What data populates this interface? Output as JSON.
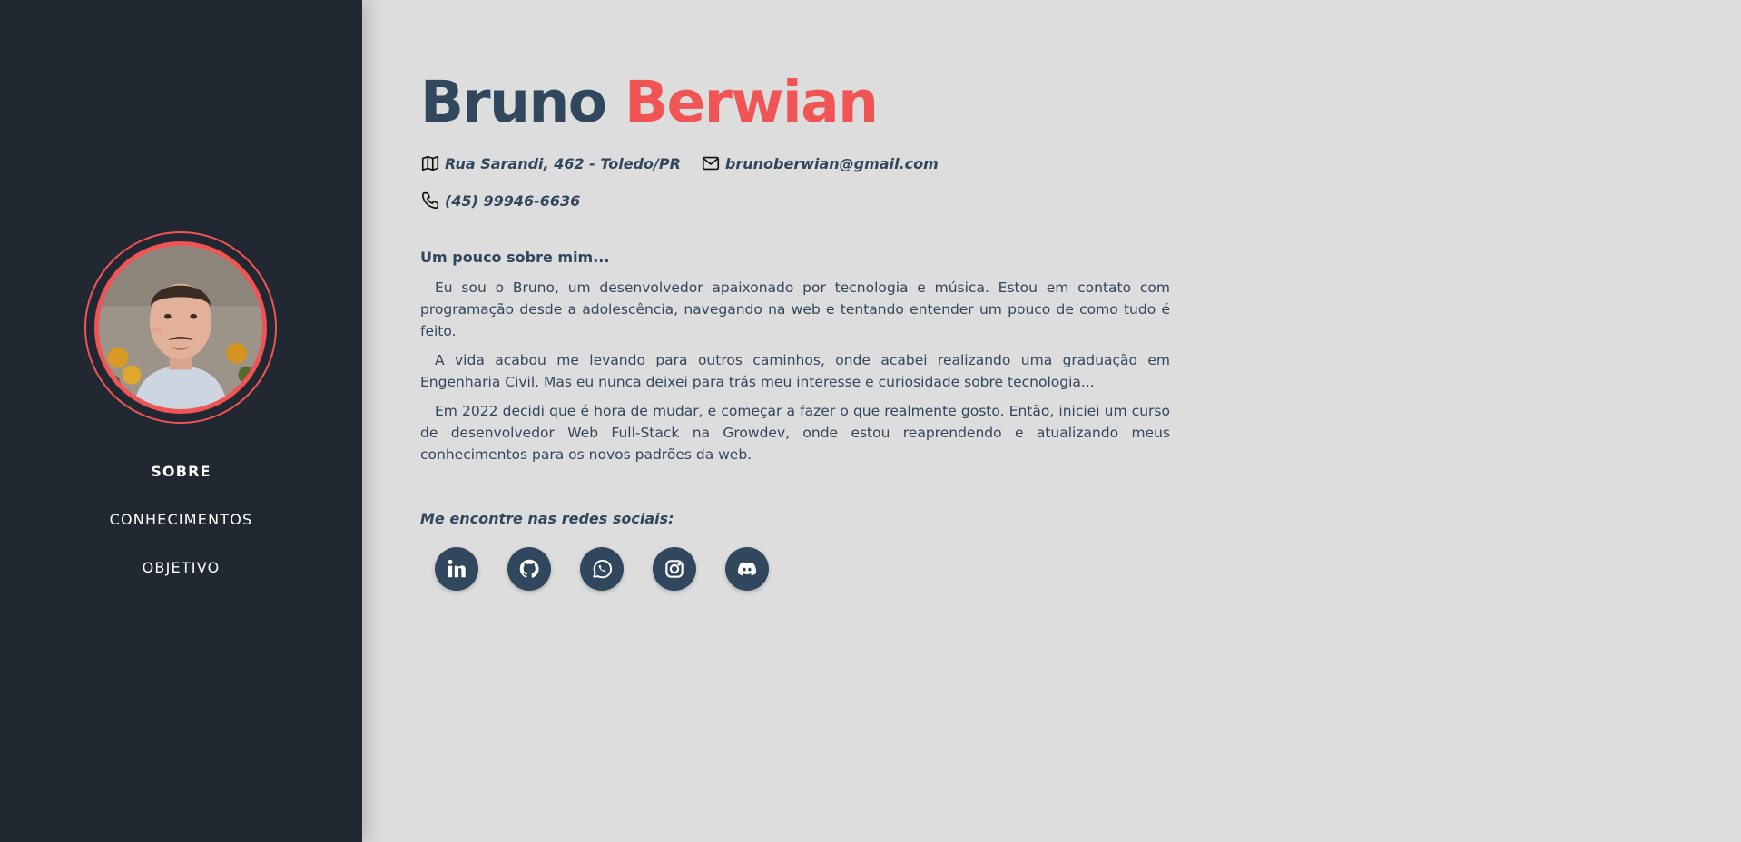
{
  "profile": {
    "first_name": "Bruno",
    "last_name": "Berwian",
    "photo_alt": "Foto de perfil"
  },
  "nav": {
    "items": [
      "SOBRE",
      "CONHECIMENTOS",
      "OBJETIVO"
    ],
    "active": "SOBRE"
  },
  "contact": {
    "address": "Rua Sarandi, 462 - Toledo/PR",
    "email": "brunoberwian@gmail.com",
    "phone": "(45) 99946-6636"
  },
  "about": {
    "title": "Um pouco sobre mim...",
    "paragraphs": [
      "Eu sou o Bruno, um desenvolvedor apaixonado por tecnologia e música. Estou em contato com programação desde a adolescência, navegando na web e tentando entender um pouco de como tudo é feito.",
      "A vida acabou me levando para outros caminhos, onde acabei realizando uma graduação em Engenharia Civil. Mas eu nunca deixei para trás meu interesse e curiosidade sobre tecnologia...",
      "Em 2022 decidi que é hora de mudar, e começar a fazer o que realmente gosto. Então, iniciei um curso de desenvolvedor Web Full-Stack na Growdev, onde estou reaprendendo e atualizando meus conhecimentos para os novos padrões da web."
    ]
  },
  "social": {
    "title": "Me encontre nas redes sociais:",
    "icons": [
      "linkedin-icon",
      "github-icon",
      "whatsapp-icon",
      "instagram-icon",
      "discord-icon"
    ]
  },
  "colors": {
    "sidebar_bg": "#222831",
    "main_bg": "#dddddd",
    "primary": "#30475e",
    "accent": "#f05454",
    "nav_text": "#ffffff"
  }
}
